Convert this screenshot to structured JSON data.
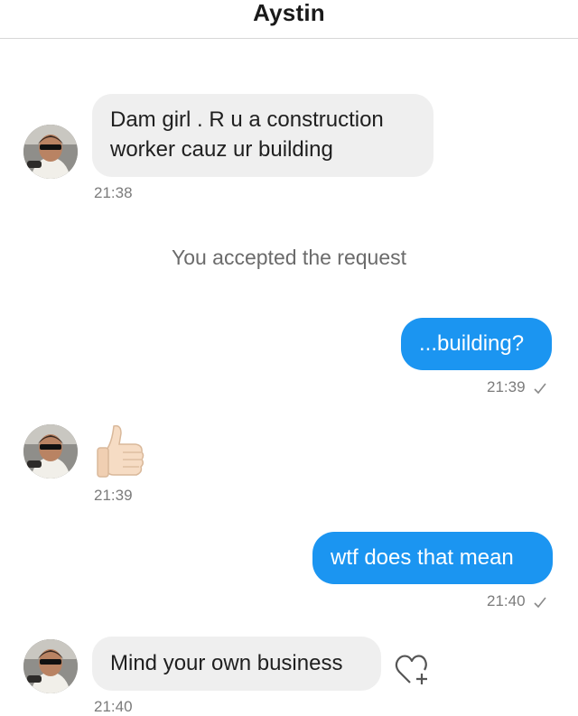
{
  "header": {
    "title": "Aystin"
  },
  "messages": [
    {
      "direction": "incoming",
      "text": "Dam girl . R u a construction worker cauz ur building",
      "time": "21:38"
    },
    {
      "type": "system",
      "text": "You accepted the request"
    },
    {
      "direction": "outgoing",
      "text": "...building?",
      "time": "21:39",
      "status_icon": "check-icon"
    },
    {
      "direction": "incoming",
      "emoji": "thumbs-up",
      "time": "21:39"
    },
    {
      "direction": "outgoing",
      "text": "wtf does that mean",
      "time": "21:40",
      "status_icon": "check-icon"
    },
    {
      "direction": "incoming",
      "text": "Mind your own business",
      "time": "21:40",
      "action_icon": "heart-add-icon"
    }
  ],
  "colors": {
    "outgoing_bubble": "#1b95f1",
    "incoming_bubble": "#efefef",
    "timestamp": "#7b7b7b"
  }
}
